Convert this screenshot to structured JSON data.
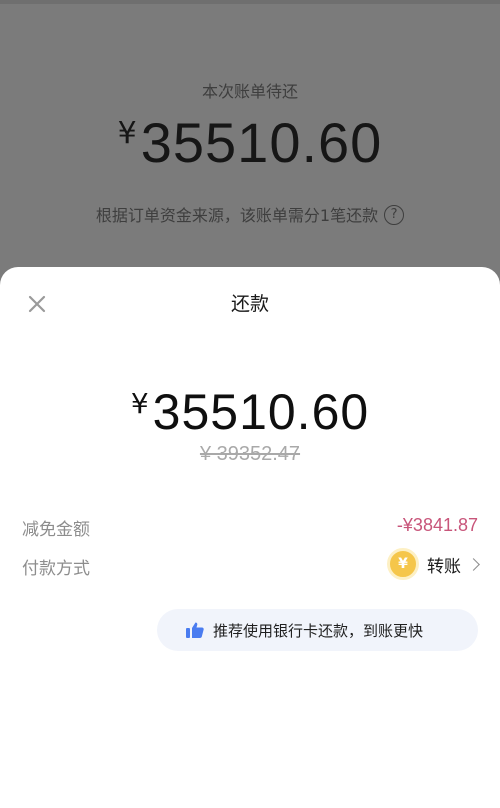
{
  "background": {
    "label": "本次账单待还",
    "currency": "¥",
    "amount": "35510.60",
    "note": "根据订单资金来源，该账单需分1笔还款",
    "help_glyph": "?"
  },
  "sheet": {
    "title": "还款",
    "pay_currency": "¥",
    "pay_amount": "35510.60",
    "original_amount": "¥ 39352.47",
    "discount_label": "减免金额",
    "discount_value": "-¥3841.87",
    "method_label": "付款方式",
    "method_icon_glyph": "¥",
    "method_value": "转账",
    "tip": "推荐使用银行卡还款，到账更快"
  },
  "colors": {
    "discount": "#c8557a",
    "coin": "#f5c64a",
    "thumb": "#4a7cf0",
    "tip_bg": "#f1f4fb"
  },
  "icons": [
    "close-icon",
    "question-circle-icon",
    "coin-icon",
    "chevron-right-icon",
    "thumbs-up-icon"
  ]
}
